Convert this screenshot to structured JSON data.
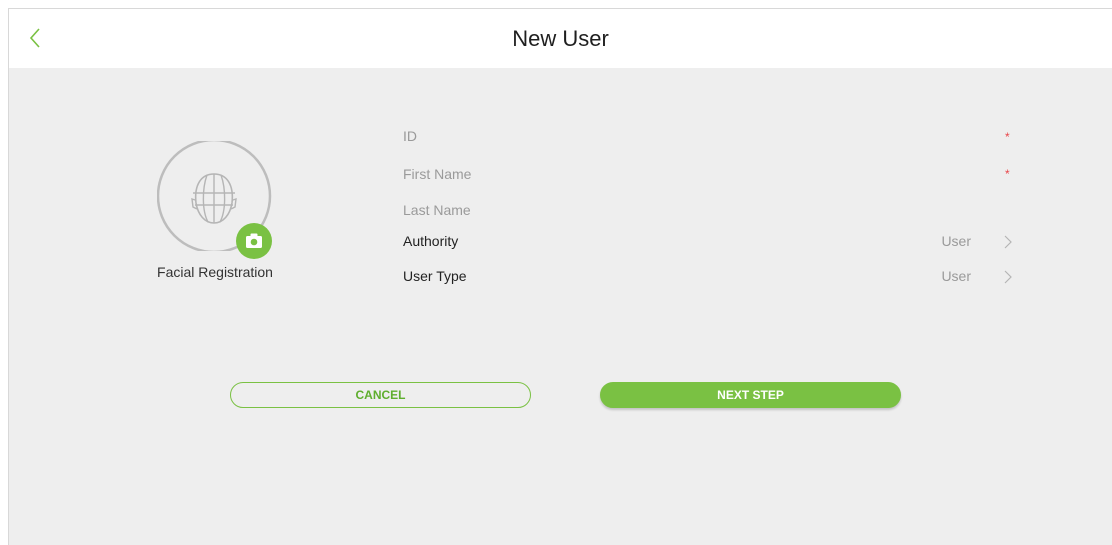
{
  "header": {
    "title": "New User",
    "back_icon": "chevron-left-icon"
  },
  "face": {
    "label": "Facial Registration",
    "icon": "face-outline-icon",
    "camera_icon": "camera-icon"
  },
  "form": {
    "fields": [
      {
        "label": "ID",
        "required": true
      },
      {
        "label": "First Name",
        "required": true
      },
      {
        "label": "Last Name",
        "required": false
      }
    ],
    "selects": [
      {
        "label": "Authority",
        "value": "User"
      },
      {
        "label": "User Type",
        "value": "User"
      }
    ],
    "required_mark": "*"
  },
  "actions": {
    "cancel_label": "CANCEL",
    "next_label": "NEXT STEP"
  },
  "colors": {
    "accent": "#7ac143",
    "required": "#e8464a",
    "background": "#eeeeee"
  }
}
